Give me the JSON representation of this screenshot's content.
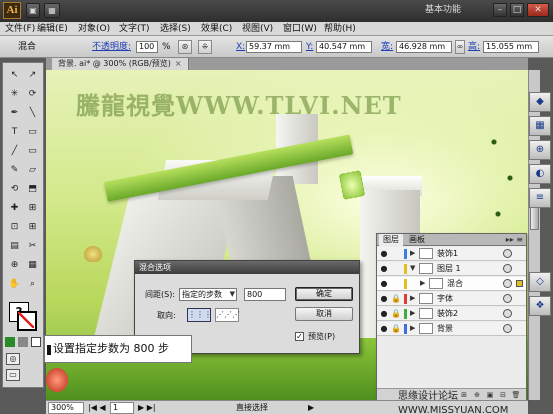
{
  "app": {
    "logo": "Ai",
    "workspace": "基本功能"
  },
  "window_controls": {
    "minimize": "–",
    "restore": "□",
    "close": "✕"
  },
  "menu": [
    "文件(F)",
    "编辑(E)",
    "对象(O)",
    "文字(T)",
    "选择(S)",
    "效果(C)",
    "视图(V)",
    "窗口(W)",
    "帮助(H)"
  ],
  "control_bar": {
    "mode_label": "混合",
    "opacity_label": "不透明度:",
    "opacity_value": "100",
    "opacity_unit": "%",
    "x_label": "X:",
    "x_value": "59.37 mm",
    "y_label": "Y:",
    "y_value": "40.547 mm",
    "w_label": "宽:",
    "w_value": "46.928 mm",
    "h_label": "高:",
    "h_value": "15.055 mm"
  },
  "document_tab": {
    "title": "背景. ai* @ 300% (RGB/预览)",
    "close": "×"
  },
  "canvas": {
    "watermark": "騰龍視覺WWW.TLVI.NET"
  },
  "tools": [
    "↖",
    "↗",
    "✳",
    "⟳",
    "✒",
    "╲",
    "T",
    "▭",
    "╱",
    "▭",
    "✎",
    "▱",
    "⟲",
    "⬒",
    "✚",
    "⊞",
    "⊡",
    "⊞",
    "▤",
    "✂",
    "⊕",
    "▦",
    "✋",
    "⌕"
  ],
  "status_bar": {
    "zoom": "300%",
    "page": "1",
    "tool_name": "直接选择"
  },
  "layers_panel": {
    "tabs": [
      "图层",
      "画板"
    ],
    "menu_icon": "▸▸ ≡",
    "rows": [
      {
        "name": "装饰1",
        "color": "#3b7fe0",
        "indent": 0,
        "expanded": false,
        "selected": false,
        "eye": "●",
        "lock": ""
      },
      {
        "name": "图层 1",
        "color": "#e0c020",
        "indent": 0,
        "expanded": true,
        "selected": false,
        "eye": "●",
        "lock": ""
      },
      {
        "name": "混合",
        "color": "#e0c020",
        "indent": 1,
        "expanded": false,
        "selected": true,
        "eye": "●",
        "lock": ""
      },
      {
        "name": "字体",
        "color": "#e03a3a",
        "indent": 0,
        "expanded": false,
        "selected": false,
        "eye": "●",
        "lock": "🔒"
      },
      {
        "name": "装饰2",
        "color": "#3ab040",
        "indent": 0,
        "expanded": false,
        "selected": false,
        "eye": "●",
        "lock": "🔒"
      },
      {
        "name": "背景",
        "color": "#3a70e0",
        "indent": 0,
        "expanded": false,
        "selected": false,
        "eye": "●",
        "lock": "🔒"
      }
    ],
    "footer_icons": [
      "⊞",
      "⊕",
      "▣",
      "⊟",
      "🗑"
    ]
  },
  "blend_dialog": {
    "title": "混合选项",
    "spacing_label": "间距(S):",
    "spacing_option": "指定的步数",
    "spacing_value": "800",
    "orientation_label": "取向:",
    "ok": "确定",
    "cancel": "取消",
    "preview_label": "预览(P)",
    "preview_checked": "✓"
  },
  "callout": {
    "text": "设置指定步数为 800 步"
  },
  "footer_watermark": "思缘设计论坛 WWW.MISSYUAN.COM",
  "dock_icons": [
    "◆",
    "▦",
    "⊕",
    "◐",
    "≡",
    "◇",
    "❖"
  ]
}
